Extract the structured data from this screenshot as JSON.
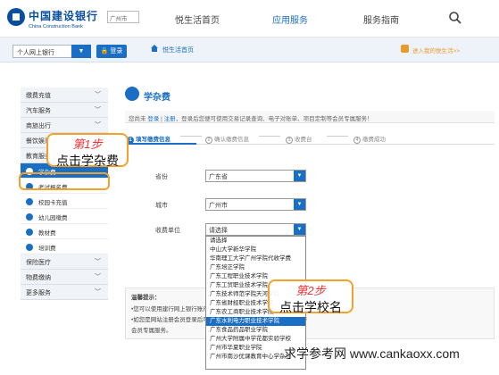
{
  "header": {
    "logo_cn": "中国建设银行",
    "logo_en": "China Construction Bank",
    "city": "广州市",
    "nav": [
      "悦生活首页",
      "应用服务",
      "服务指南"
    ]
  },
  "subbar": {
    "account_type": "个人网上银行",
    "login": "登录",
    "breadcrumb": "悦生活首页",
    "my_payments": "进入我的悦生活>>"
  },
  "sidebar": {
    "items_top": [
      "缴费充值",
      "汽车服务",
      "商旅出行",
      "餐饮娱乐",
      "教育服务"
    ],
    "sub_items": [
      "学杂费",
      "考试报名费",
      "校园卡充值",
      "幼儿园缴费",
      "教材费",
      "培训费"
    ],
    "items_bottom": [
      "保险医疗",
      "物费缴纳",
      "更多服务"
    ]
  },
  "main": {
    "title": "学杂费",
    "notice_prefix": "您尚未",
    "login_link": "登录",
    "sep": "|",
    "register_link": "注册",
    "notice_suffix": "，登录后您便可使用交易记录查询、电子对账单、项目定制等会员专属服务！",
    "steps": [
      "填写缴费信息",
      "确认缴费信息",
      "收费台",
      "缴费成功"
    ],
    "step_nums": [
      "1",
      "2",
      "3",
      "4"
    ],
    "fields": {
      "province_label": "省份",
      "province_value": "广东省",
      "city_label": "城市",
      "city_value": "广州市",
      "unit_label": "收费单位",
      "unit_value": "请选择"
    },
    "dropdown_options": [
      "请选择",
      "中山大学新华学院",
      "华南理工大学广州学院代收学费",
      "广东培正学院",
      "广东工程职业技术学院",
      "广东工贸职业技术学院",
      "广东技术师范学院天河学院",
      "广东省财经职业技术学校",
      "广东农工商职业技术学院",
      "广东水利电力职业技术学院",
      "广东食品药品职业学院",
      "广州大学附属中学花都实验学校",
      "广州市华夏职业学院",
      "广州市南沙优课教育中心学杂费"
    ],
    "selected_option_index": 9,
    "tips": {
      "title": "温馨提示：",
      "line1": "•您可以使用建行网上银行账户进行缴费",
      "line2": "•如您是网站注册会员登录后可查询交易明细，并可以使用项目定制等",
      "line3": "会员专属服务。"
    }
  },
  "annotations": {
    "step1_title": "第1步",
    "step1_text": "点击学杂费",
    "step2_title": "第2步",
    "step2_text": "点击学校名"
  },
  "watermark": "求学参考网 www.cankaoxx.com",
  "colors": {
    "brand": "#1a6fc4",
    "accent": "#f2a22c",
    "logo": "#0a4ea0"
  }
}
